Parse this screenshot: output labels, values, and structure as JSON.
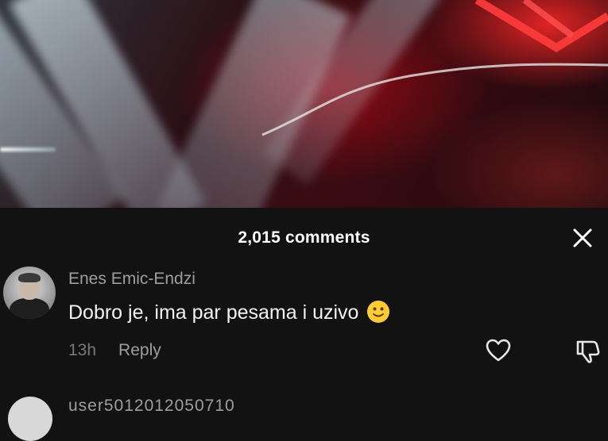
{
  "video": {
    "description_icon": "concert-video"
  },
  "comments_sheet": {
    "title": "2,015 comments",
    "close_icon": "close-icon"
  },
  "comment": {
    "username": "Enes Emic-Endzi",
    "text": "Dobro je, ima par pesama i uzivo",
    "emoji": "slightly-smiling-face",
    "time": "13h",
    "reply_label": "Reply",
    "like_icon": "heart-icon",
    "dislike_icon": "thumbs-down-icon"
  },
  "next_comment": {
    "username": "user5012012050710"
  },
  "colors": {
    "background": "#121212",
    "text_primary": "#ffffff",
    "text_secondary": "#9e9e9e",
    "emoji_yellow": "#ffcc33"
  }
}
